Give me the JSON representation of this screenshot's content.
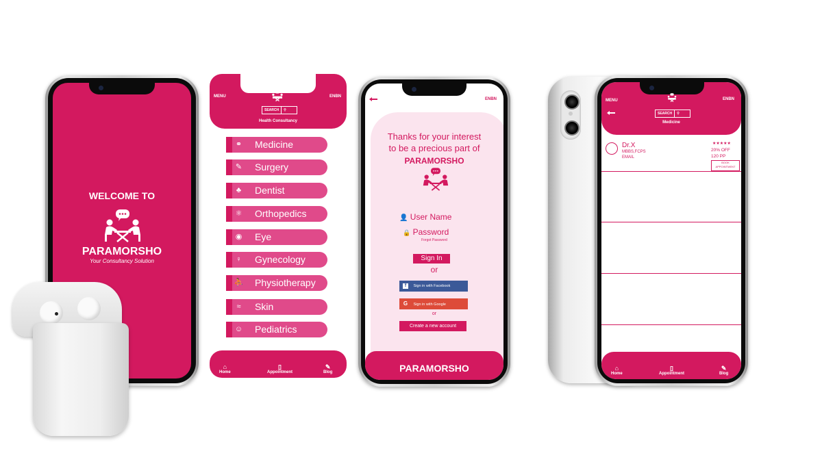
{
  "colors": {
    "brand_pink": "#d3195f",
    "light_pink": "#e04a8a",
    "pale_pink": "#fbe4ee"
  },
  "splash": {
    "welcome": "WELCOME TO",
    "brand": "PARAMORSHO",
    "tagline": "Your Consultancy Solution"
  },
  "categories_screen": {
    "menu": "MENU",
    "lang": "ENBN",
    "search_label": "SEARCH",
    "subtitle": "Health Consultancy",
    "items": [
      {
        "label": "Medicine",
        "icon": "pill-icon"
      },
      {
        "label": "Surgery",
        "icon": "scalpel-icon"
      },
      {
        "label": "Dentist",
        "icon": "tooth-icon"
      },
      {
        "label": "Orthopedics",
        "icon": "bone-icon"
      },
      {
        "label": "Eye",
        "icon": "eye-icon"
      },
      {
        "label": "Gynecology",
        "icon": "uterus-icon"
      },
      {
        "label": "Physiotherapy",
        "icon": "physio-icon"
      },
      {
        "label": "Skin",
        "icon": "skin-icon"
      },
      {
        "label": "Pediatrics",
        "icon": "baby-icon"
      }
    ],
    "nav": {
      "home": "Home",
      "appointment": "Appointment",
      "blog": "Blog"
    }
  },
  "login_screen": {
    "lang": "ENBN",
    "intro_line1": "Thanks for your interest",
    "intro_line2": "to be a precious part of",
    "brand": "PARAMORSHO",
    "username_placeholder": "User Name",
    "password_placeholder": "Password",
    "forgot": "Forgot Password",
    "sign_in": "Sign In",
    "or1": "or",
    "facebook": "Sign in with Facebook",
    "google": "Sign in with Google",
    "or2": "or",
    "create": "Create a new account",
    "footer_brand": "PARAMORSHO"
  },
  "doctor_screen": {
    "menu": "MENU",
    "lang": "ENBN",
    "search_label": "SEARCH",
    "title": "Medicine",
    "doctor": {
      "name": "Dr.X",
      "degree": "MBBS,FCPS",
      "email": "EMAIL",
      "rating": "★★★★★",
      "discount": "20% OFF",
      "fee": "120 PP",
      "book": "BOOK APPOINTMENT"
    },
    "nav": {
      "home": "Home",
      "appointment": "Appointment",
      "blog": "Blog"
    }
  }
}
